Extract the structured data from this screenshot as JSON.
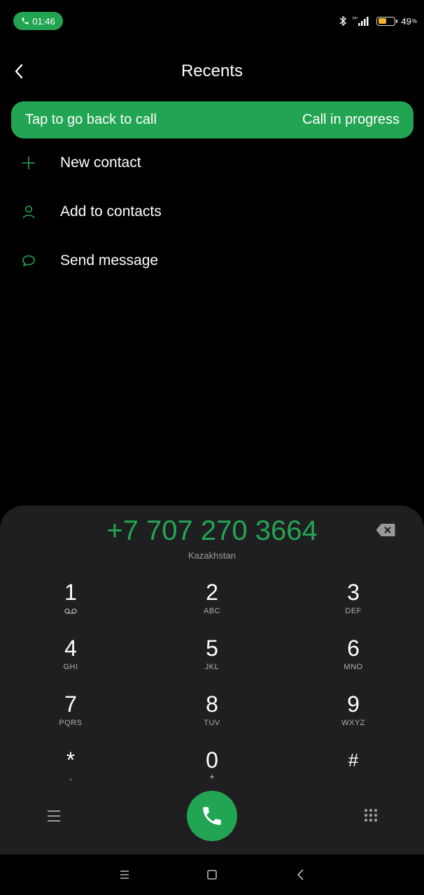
{
  "status_bar": {
    "time": "01:46",
    "battery_percent": "49",
    "battery_unit": "%",
    "battery_level": 0.49,
    "icons": [
      "phone-icon",
      "bluetooth-icon",
      "signal-icon",
      "battery-icon"
    ]
  },
  "header": {
    "title": "Recents",
    "back_icon": "chevron-left-icon"
  },
  "call_banner": {
    "left_text": "Tap to go back to call",
    "right_text": "Call in progress"
  },
  "actions": [
    {
      "icon": "plus-icon",
      "label": "New contact"
    },
    {
      "icon": "person-icon",
      "label": "Add to contacts"
    },
    {
      "icon": "message-icon",
      "label": "Send message"
    }
  ],
  "dialpad": {
    "number": "+7 707 270 3664",
    "region": "Kazakhstan",
    "keys": [
      {
        "digit": "1",
        "sub": ""
      },
      {
        "digit": "2",
        "sub": "ABC"
      },
      {
        "digit": "3",
        "sub": "DEF"
      },
      {
        "digit": "4",
        "sub": "GHI"
      },
      {
        "digit": "5",
        "sub": "JKL"
      },
      {
        "digit": "6",
        "sub": "MNO"
      },
      {
        "digit": "7",
        "sub": "PQRS"
      },
      {
        "digit": "8",
        "sub": "TUV"
      },
      {
        "digit": "9",
        "sub": "WXYZ"
      },
      {
        "digit": "*",
        "sub": ","
      },
      {
        "digit": "0",
        "sub": "+"
      },
      {
        "digit": "#",
        "sub": ""
      }
    ]
  },
  "colors": {
    "accent": "#22a553",
    "dialpad_bg": "#1f1f21",
    "battery": "#f3b42f"
  }
}
